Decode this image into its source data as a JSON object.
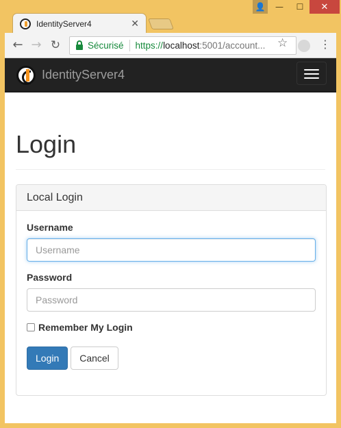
{
  "window": {
    "controls": {
      "user": "👤",
      "minimize": "—",
      "maximize": "☐",
      "close": "✕"
    }
  },
  "tab": {
    "title": "IdentityServer4",
    "close": "✕"
  },
  "toolbar": {
    "back": "←",
    "forward": "→",
    "reload": "↻",
    "security_label": "Sécurisé",
    "url_scheme": "https://",
    "url_host": "localhost",
    "url_rest": ":5001/account...",
    "bookmark": "☆",
    "menu": "⋮"
  },
  "navbar": {
    "brand": "IdentityServer4"
  },
  "page": {
    "title": "Login",
    "panel_heading": "Local Login",
    "username": {
      "label": "Username",
      "placeholder": "Username",
      "value": ""
    },
    "password": {
      "label": "Password",
      "placeholder": "Password",
      "value": ""
    },
    "remember_label": "Remember My Login",
    "login_button": "Login",
    "cancel_button": "Cancel"
  },
  "colors": {
    "window_frame": "#f2c462",
    "navbar_bg": "#222222",
    "primary": "#337ab7",
    "secure_green": "#178a3c"
  }
}
